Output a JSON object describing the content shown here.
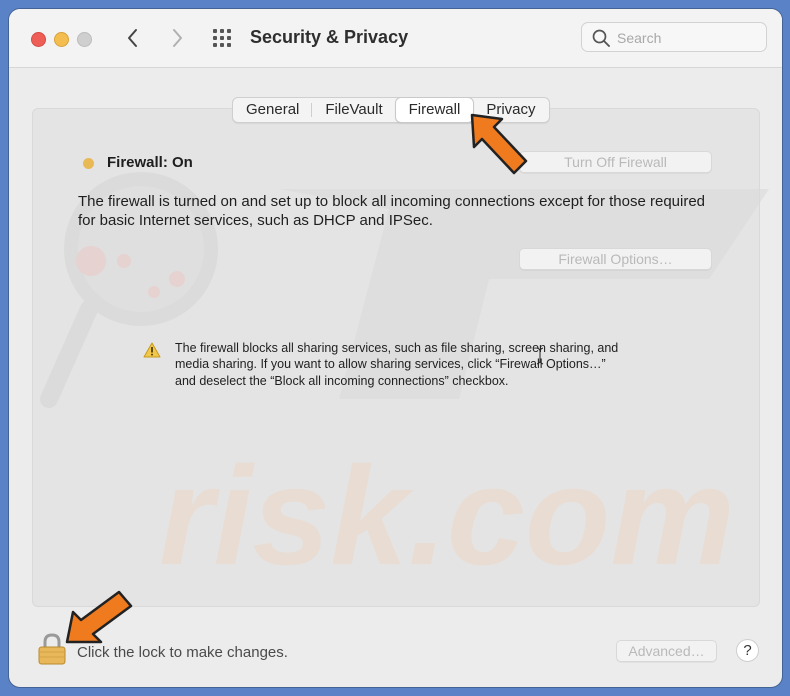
{
  "window": {
    "title": "Security & Privacy"
  },
  "search": {
    "placeholder": "Search"
  },
  "tabs": [
    {
      "label": "General",
      "active": false
    },
    {
      "label": "FileVault",
      "active": false
    },
    {
      "label": "Firewall",
      "active": true
    },
    {
      "label": "Privacy",
      "active": false
    }
  ],
  "firewall": {
    "status_label": "Firewall: On",
    "status_color": "#e8b954",
    "turn_off_button": "Turn Off Firewall",
    "description": "The firewall is turned on and set up to block all incoming connections except for those required for basic Internet services, such as DHCP and IPSec.",
    "options_button": "Firewall Options…",
    "warning": "The firewall blocks all sharing services, such as file sharing, screen sharing, and media sharing. If you want to allow sharing services, click “Firewall Options…” and deselect the “Block all incoming connections” checkbox."
  },
  "footer": {
    "lock_message": "Click the lock to make changes.",
    "advanced_button": "Advanced…",
    "help_button": "?"
  },
  "watermark": {
    "text": "risk.com"
  },
  "colors": {
    "accent_arrow": "#f07b1f",
    "background": "#5a83c7"
  },
  "icons": [
    "back-chevron-icon",
    "forward-chevron-icon",
    "grid-icon",
    "search-icon",
    "warning-icon",
    "padlock-icon",
    "arrow-icon"
  ]
}
